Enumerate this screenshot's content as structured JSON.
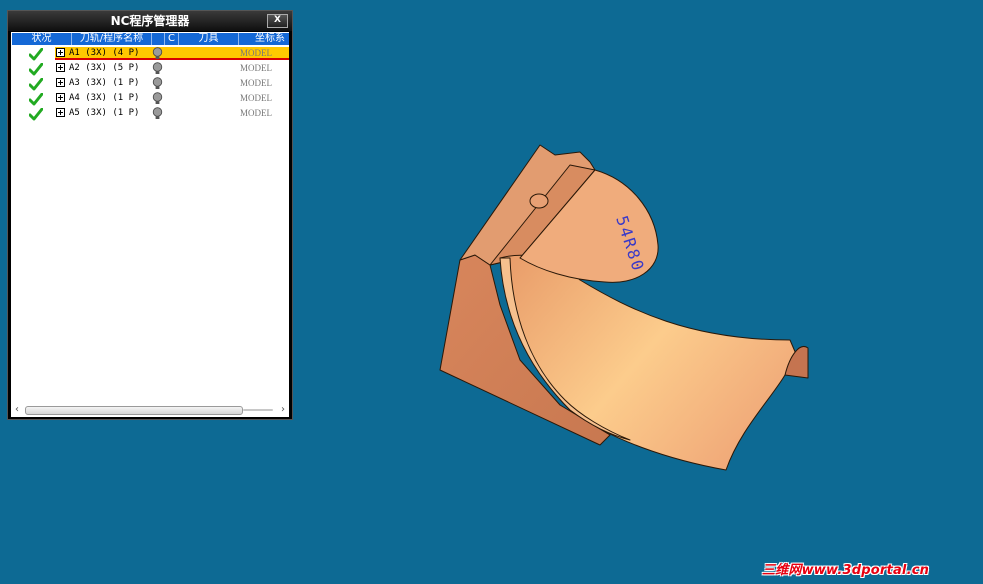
{
  "window": {
    "title": "NC程序管理器",
    "close_label": "X"
  },
  "table": {
    "columns": [
      "状况",
      "刀轨/程序名称",
      "C",
      "刀具",
      "坐标系"
    ],
    "rows": [
      {
        "name": "A1 (3X) (4 P)",
        "coord": "MODEL",
        "status_icon": "check-icon",
        "selected": true
      },
      {
        "name": "A2 (3X) (5 P)",
        "coord": "MODEL",
        "status_icon": "check-icon",
        "selected": false
      },
      {
        "name": "A3 (3X) (1 P)",
        "coord": "MODEL",
        "status_icon": "check-icon",
        "selected": false
      },
      {
        "name": "A4 (3X) (1 P)",
        "coord": "MODEL",
        "status_icon": "check-icon",
        "selected": false
      },
      {
        "name": "A5 (3X) (1 P)",
        "coord": "MODEL",
        "status_icon": "check-icon",
        "selected": false
      }
    ]
  },
  "model": {
    "engraving": "54R80"
  },
  "watermark": "三维网www.3dportal.cn",
  "colors": {
    "background": "#0d6a94",
    "model": "#e8a070",
    "selected_row": "#ffc800",
    "header": "#1468d6",
    "check": "#22aa22"
  }
}
